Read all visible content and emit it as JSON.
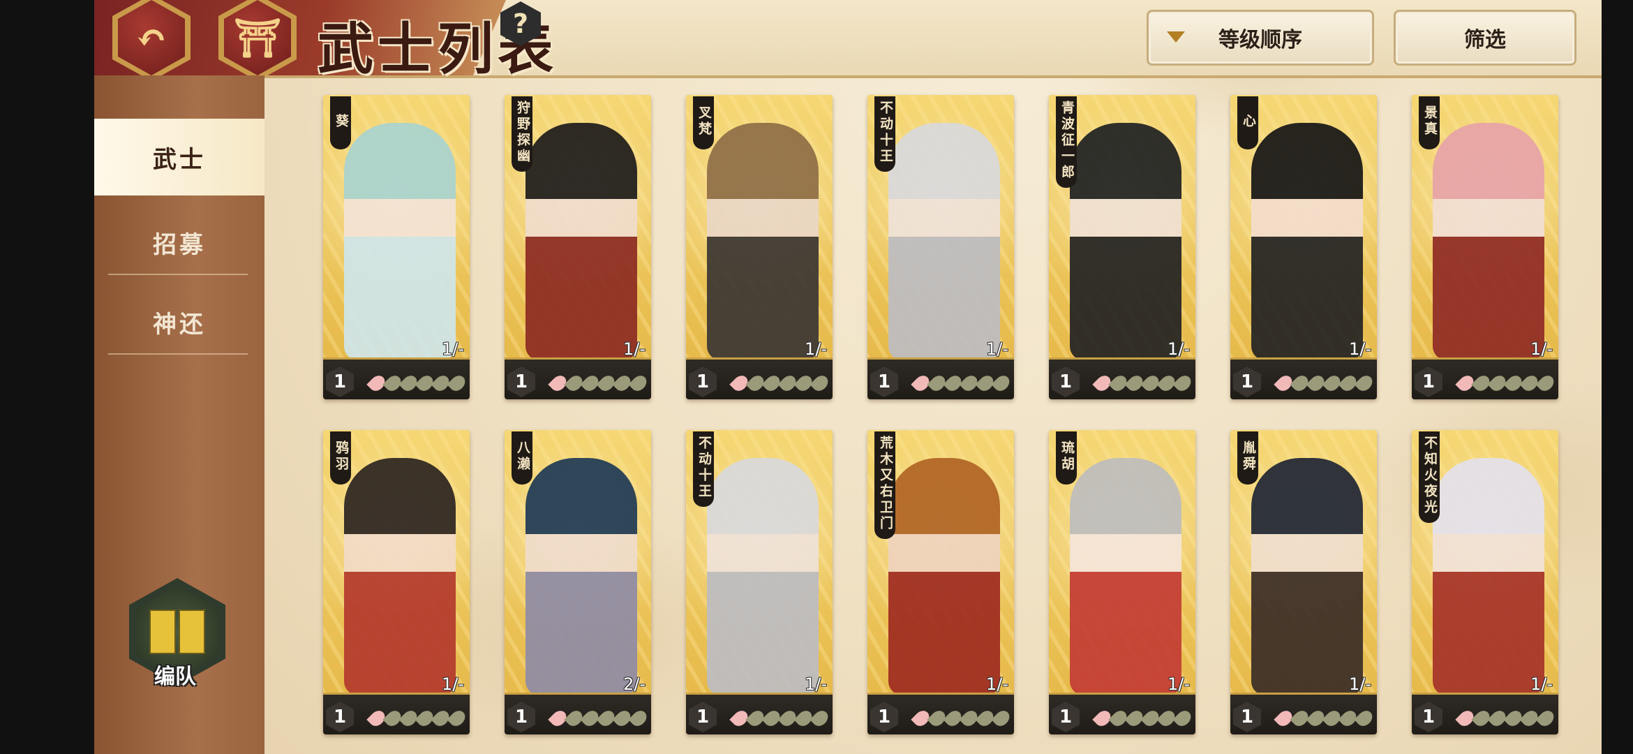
{
  "header": {
    "title": "武士列表",
    "back_icon": "back-arrow-icon",
    "home_icon": "home-gate-icon",
    "help_label": "?",
    "sort_label": "等级顺序",
    "filter_label": "筛选"
  },
  "sidebar": {
    "items": [
      {
        "label": "武士",
        "active": true
      },
      {
        "label": "招募",
        "active": false
      },
      {
        "label": "神还",
        "active": false
      }
    ],
    "team_label": "编队"
  },
  "cards": [
    {
      "name": "葵",
      "qty": "1/-",
      "level": "1",
      "hair": "#a9d3cf",
      "skin": "#f3e3d5",
      "robe": "#cfe6ea"
    },
    {
      "name": "狩野探幽",
      "qty": "1/-",
      "level": "1",
      "hair": "#1d1b1b",
      "skin": "#f0dccb",
      "robe": "#8c2a22"
    },
    {
      "name": "叉梵",
      "qty": "1/-",
      "level": "1",
      "hair": "#8e6d45",
      "skin": "#ead7c5",
      "robe": "#3a3532"
    },
    {
      "name": "不动十王",
      "qty": "1/-",
      "level": "1",
      "hair": "#d9d9dc",
      "skin": "#efe2d8",
      "robe": "#bcbcc2"
    },
    {
      "name": "青波征一郎",
      "qty": "1/-",
      "level": "1",
      "hair": "#1e2022",
      "skin": "#efe0d2",
      "robe": "#222"
    },
    {
      "name": "心",
      "qty": "1/-",
      "level": "1",
      "hair": "#151515",
      "skin": "#f3ddcc",
      "robe": "#222"
    },
    {
      "name": "景真",
      "qty": "1/-",
      "level": "1",
      "hair": "#e7a3a8",
      "skin": "#f2dfd3",
      "robe": "#8f2a24"
    },
    {
      "name": "鸦羽",
      "qty": "1/-",
      "level": "1",
      "hair": "#2b2320",
      "skin": "#f1dbc6",
      "robe": "#b3392c"
    },
    {
      "name": "八濑",
      "qty": "2/-",
      "level": "1",
      "hair": "#1e3a55",
      "skin": "#efdccb",
      "robe": "#8e8ba5"
    },
    {
      "name": "不动十王",
      "qty": "1/-",
      "level": "1",
      "hair": "#d9d9dc",
      "skin": "#efe2d8",
      "robe": "#bcbcc2"
    },
    {
      "name": "荒木又右卫门",
      "qty": "1/-",
      "level": "1",
      "hair": "#b06424",
      "skin": "#efd3bd",
      "robe": "#9e2a20"
    },
    {
      "name": "琉胡",
      "qty": "1/-",
      "level": "1",
      "hair": "#bdbdbd",
      "skin": "#f5e5d9",
      "robe": "#c33b34"
    },
    {
      "name": "胤舜",
      "qty": "1/-",
      "level": "1",
      "hair": "#1f2534",
      "skin": "#f0decd",
      "robe": "#3a2c26"
    },
    {
      "name": "不知火夜光",
      "qty": "1/-",
      "level": "1",
      "hair": "#e4e1ec",
      "skin": "#f2e2d8",
      "robe": "#a63229"
    }
  ]
}
